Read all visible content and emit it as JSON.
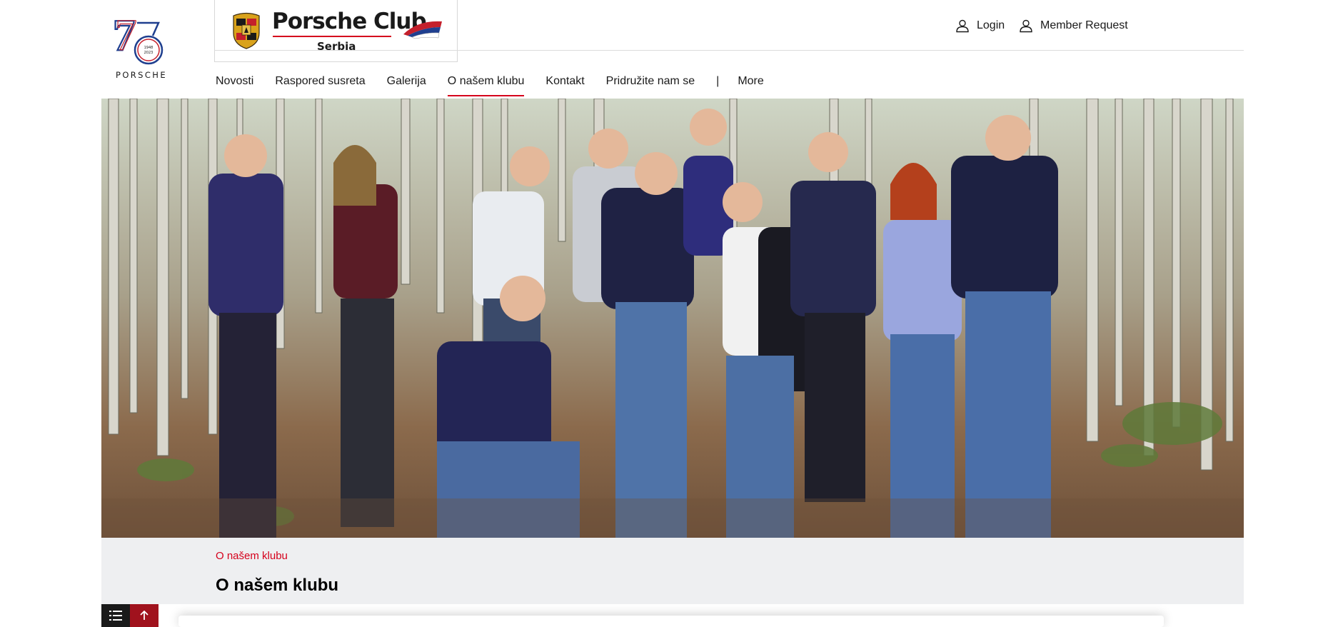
{
  "brand": {
    "logo_text": "PORSCHE",
    "anniversary": "75",
    "anniversary_years": "1948 2023",
    "club_title": "Porsche Club",
    "club_subtitle": "Serbia"
  },
  "header": {
    "login_label": "Login",
    "member_request_label": "Member Request"
  },
  "nav": {
    "items": [
      {
        "label": "Novosti"
      },
      {
        "label": "Raspored susreta"
      },
      {
        "label": "Galerija"
      },
      {
        "label": "O našem klubu",
        "active": true
      },
      {
        "label": "Kontakt"
      },
      {
        "label": "Pridružite nam se"
      }
    ],
    "separator": "|",
    "more_label": "More"
  },
  "page": {
    "breadcrumb": "O našem klubu",
    "title": "O našem klubu"
  },
  "colors": {
    "accent": "#d5001c",
    "band_background": "#eeeff1",
    "dark": "#1a1a1a"
  },
  "icons": {
    "login": "user-icon",
    "member_request": "user-icon",
    "toc": "list-icon",
    "back_to_top": "arrow-up-icon"
  }
}
